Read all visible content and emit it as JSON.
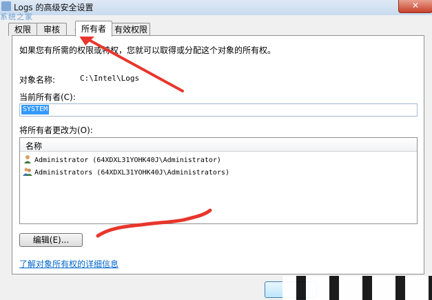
{
  "window": {
    "title": "Logs 的高级安全设置",
    "watermark": "系统之家",
    "close_label": "✕"
  },
  "tabs": [
    {
      "label": "权限"
    },
    {
      "label": "审核"
    },
    {
      "label": "所有者",
      "active": true
    },
    {
      "label": "有效权限"
    }
  ],
  "owner_tab": {
    "intro": "如果您有所需的权限或特权，您就可以取得或分配这个对象的所有权。",
    "object_name_label": "对象名称:",
    "object_name_value": "C:\\Intel\\Logs",
    "current_owner_label": "当前所有者(C):",
    "current_owner_value": "SYSTEM",
    "change_owner_label": "将所有者更改为(O):",
    "list": {
      "column_header": "名称",
      "items": [
        {
          "icon": "user-icon",
          "label": "Administrator (64XDXL31YOHK40J\\Administrator)"
        },
        {
          "icon": "users-group-icon",
          "label": "Administrators (64XDXL31YOHK40J\\Administrators)"
        }
      ]
    },
    "edit_button": "编辑(E)...",
    "learn_more_link": "了解对象所有权的详细信息"
  },
  "colors": {
    "annotation_red": "#e8362c",
    "link_blue": "#0066cc",
    "selection_blue": "#3399ff"
  }
}
